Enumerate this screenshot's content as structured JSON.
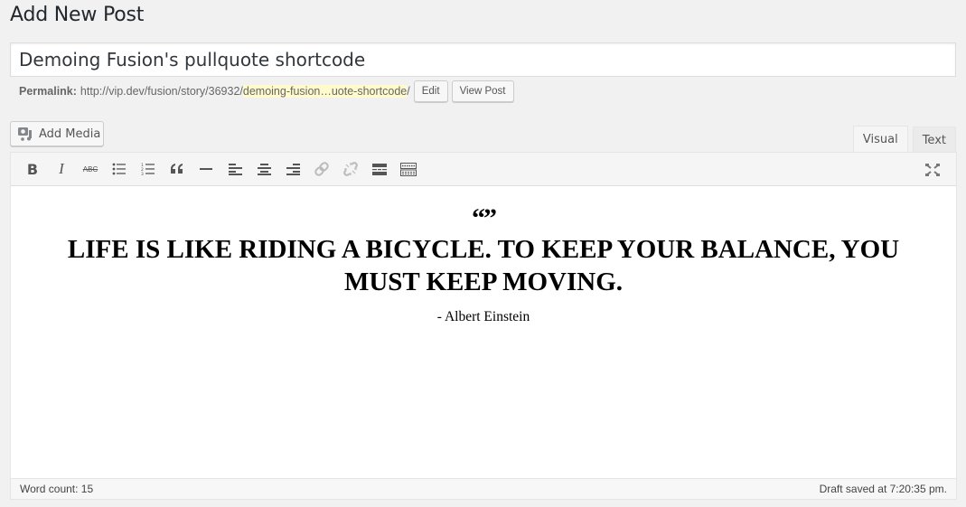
{
  "page": {
    "title": "Add New Post"
  },
  "post": {
    "title_value": "Demoing Fusion's pullquote shortcode"
  },
  "permalink": {
    "label": "Permalink:",
    "base_url": "http://vip.dev/fusion/story/36932/",
    "slug": "demoing-fusion…uote-shortcode",
    "trailing_slash": "/",
    "edit_label": "Edit",
    "view_label": "View Post",
    "slug_highlight_color": "#fffbcc"
  },
  "media": {
    "add_media_label": "Add Media"
  },
  "editor_tabs": [
    {
      "label": "Visual",
      "active": true
    },
    {
      "label": "Text",
      "active": false
    }
  ],
  "toolbar": {
    "buttons": [
      {
        "name": "bold",
        "icon": "bold-icon"
      },
      {
        "name": "italic",
        "icon": "italic-icon"
      },
      {
        "name": "strikethrough",
        "icon": "strikethrough-icon"
      },
      {
        "name": "bulleted-list",
        "icon": "bulleted-list-icon"
      },
      {
        "name": "numbered-list",
        "icon": "numbered-list-icon"
      },
      {
        "name": "blockquote",
        "icon": "blockquote-icon"
      },
      {
        "name": "horizontal-line",
        "icon": "horizontal-line-icon"
      },
      {
        "name": "align-left",
        "icon": "align-left-icon"
      },
      {
        "name": "align-center",
        "icon": "align-center-icon"
      },
      {
        "name": "align-right",
        "icon": "align-right-icon"
      },
      {
        "name": "insert-link",
        "icon": "link-icon"
      },
      {
        "name": "remove-link",
        "icon": "unlink-icon"
      },
      {
        "name": "insert-read-more",
        "icon": "read-more-icon"
      },
      {
        "name": "toolbar-toggle",
        "icon": "keyboard-icon"
      }
    ],
    "bold_glyph": "B",
    "italic_glyph": "I",
    "strike_glyph": "ABC",
    "blockquote_glyph": "“",
    "fullscreen_icon": "fullscreen-icon"
  },
  "content": {
    "quote_marks": "“”",
    "quote_text": "Life is like riding a bicycle. To keep your balance, you must keep moving.",
    "attribution": "- Albert Einstein"
  },
  "status": {
    "word_count": "Word count: 15",
    "draft_saved": "Draft saved at 7:20:35 pm."
  }
}
